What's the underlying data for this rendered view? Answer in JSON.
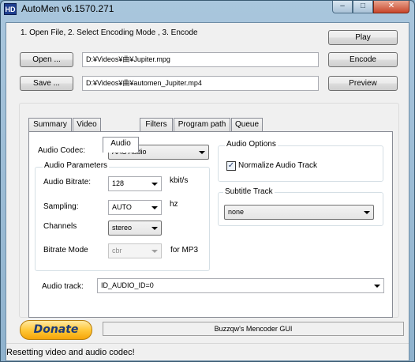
{
  "window": {
    "icon_text": "HD",
    "title": "AutoMen v6.1570.271",
    "minimize_glyph": "–",
    "maximize_glyph": "□",
    "close_glyph": "✕"
  },
  "header": {
    "instructions": "1. Open File, 2. Select Encoding Mode , 3. Encode",
    "play_label": "Play",
    "encode_label": "Encode",
    "preview_label": "Preview"
  },
  "files": {
    "open_label": "Open ...",
    "open_path": "D:¥Videos¥曲¥Jupiter.mpg",
    "save_label": "Save ...",
    "save_path": "D:¥Videos¥曲¥automen_Jupiter.mp4"
  },
  "tabs": [
    "Summary",
    "Video",
    "Audio",
    "Filters",
    "Program path",
    "Queue"
  ],
  "active_tab": "Audio",
  "audio": {
    "codec_label": "Audio Codec:",
    "codec_value": "AAC Audio",
    "params_title": "Audio Parameters",
    "bitrate_label": "Audio Bitrate:",
    "bitrate_value": "128",
    "bitrate_unit": "kbit/s",
    "sampling_label": "Sampling:",
    "sampling_value": "AUTO",
    "sampling_unit": "hz",
    "channels_label": "Channels",
    "channels_value": "stereo",
    "bitrate_mode_label": "Bitrate Mode",
    "bitrate_mode_value": "cbr",
    "bitrate_mode_note": "for MP3",
    "track_label": "Audio track:",
    "track_value": "ID_AUDIO_ID=0"
  },
  "options": {
    "title": "Audio Options",
    "normalize_label": "Normalize Audio Track",
    "normalize_checked": true,
    "check_glyph": "✓"
  },
  "subtitle": {
    "title": "Subtitle Track",
    "value": "none"
  },
  "footer": {
    "donate_label": "Donate",
    "credit": "Buzzqw's Mencoder GUI",
    "status": "Resetting video and audio codec!"
  }
}
